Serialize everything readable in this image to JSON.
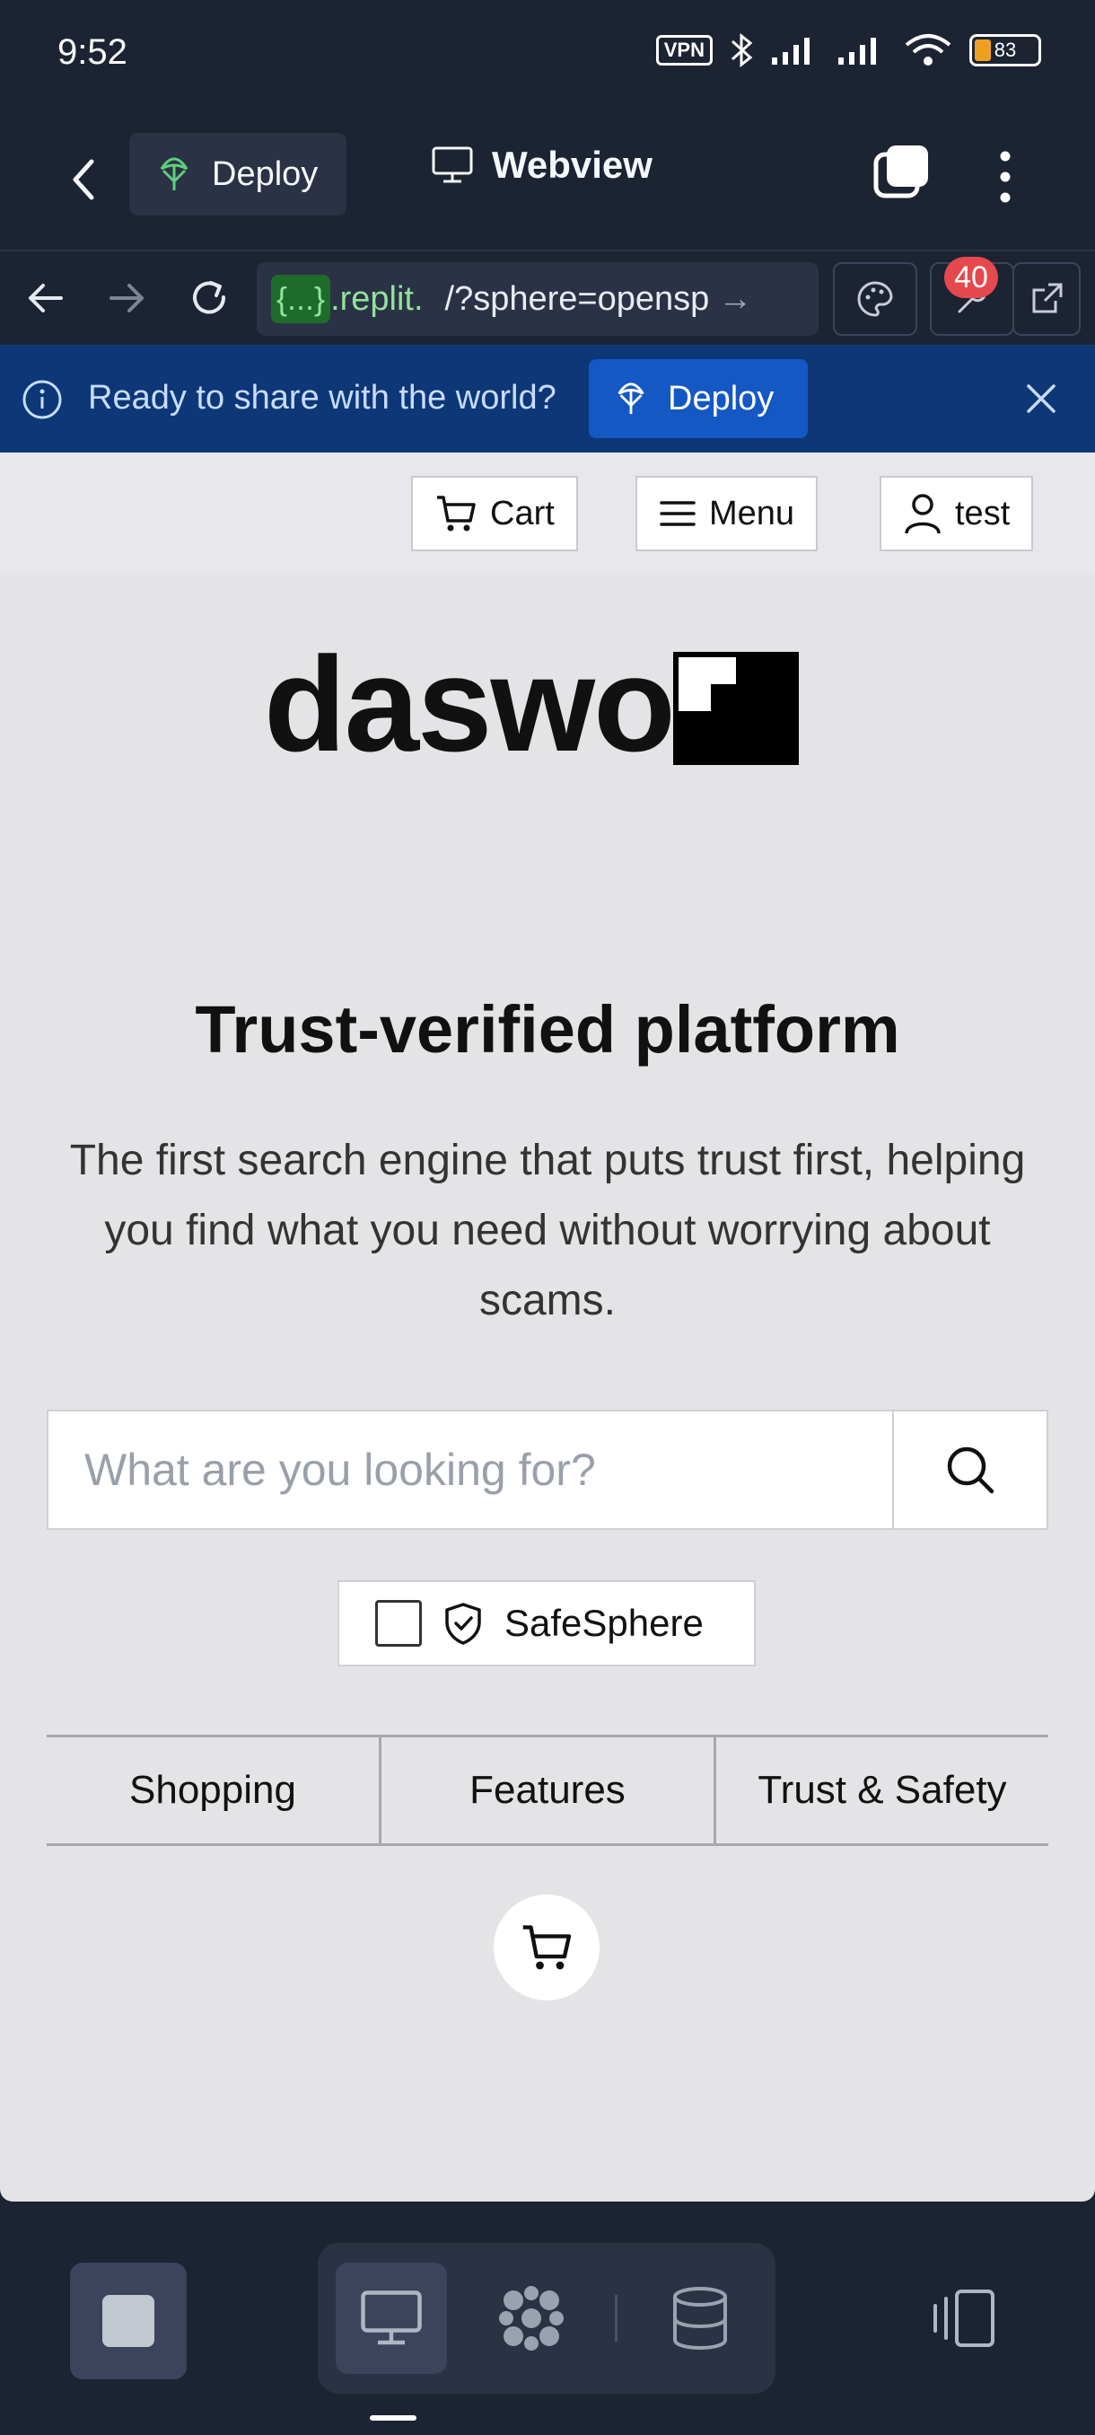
{
  "status_bar": {
    "time": "9:52",
    "vpn": "VPN",
    "battery": "83"
  },
  "topbar": {
    "deploy_label": "Deploy",
    "webview_label": "Webview"
  },
  "browser": {
    "url_chip": "{...}",
    "url_host": ".replit.",
    "url_path": "/?sphere=opensp",
    "notifications_count": "40"
  },
  "banner": {
    "text": "Ready to share with the world?",
    "deploy_label": "Deploy"
  },
  "site_header": {
    "cart_label": "Cart",
    "menu_label": "Menu",
    "user_label": "test"
  },
  "logo": {
    "text": "daswos"
  },
  "hero": {
    "title": "Trust-verified platform",
    "subtitle": "The first search engine that puts trust first, helping you find what you need without worrying about scams."
  },
  "search": {
    "placeholder": "What are you looking for?",
    "value": ""
  },
  "safesphere": {
    "label": "SafeSphere",
    "checked": false
  },
  "tabs": [
    {
      "label": "Shopping"
    },
    {
      "label": "Features"
    },
    {
      "label": "Trust & Safety"
    }
  ],
  "colors": {
    "replit_bg": "#1c2333",
    "banner_bg": "#0e3778",
    "banner_button": "#1458c4",
    "badge": "#e5484d",
    "url_green": "#8fe39a"
  }
}
